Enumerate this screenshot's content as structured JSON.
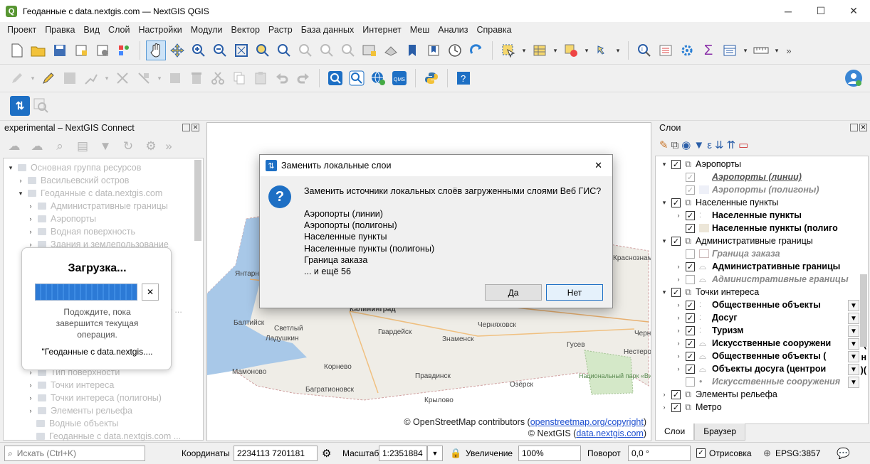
{
  "window": {
    "title": "Геоданные с data.nextgis.com — NextGIS QGIS",
    "app_icon": "Q",
    "minimize": "─",
    "maximize": "☐",
    "close": "✕"
  },
  "menu": [
    "Проект",
    "Правка",
    "Вид",
    "Слой",
    "Настройки",
    "Модули",
    "Вектор",
    "Растр",
    "База данных",
    "Интернет",
    "Меш",
    "Анализ",
    "Справка"
  ],
  "connect_panel": {
    "title": "experimental – NextGIS Connect",
    "tree": [
      "Основная группа ресурсов",
      "Васильевский остров",
      "Геоданные с data.nextgis.com",
      "Административные границы",
      "Аэропорты",
      "Водная поверхность",
      "Здания и землепользование",
      "Тип поверхности",
      "Точки интереса",
      "Точки интереса (полигоны)",
      "Элементы рельефа",
      "Водные объекты",
      "Геоданные с data.nextgis.com ..."
    ],
    "clipped_item": "е ..."
  },
  "loading": {
    "title": "Загрузка...",
    "message": "Подождите, пока завершится текущая операция.",
    "item": "\"Геоданные с data.nextgis....",
    "cancel": "✕"
  },
  "dialog": {
    "title": "Заменить локальные слои",
    "question": "Заменить источники локальных слоёв загруженными слоями Веб ГИС?",
    "layers": [
      "Аэропорты (линии)",
      "Аэропорты (полигоны)",
      "Населенные пункты",
      "Населенные пункты (полигоны)",
      "Граница заказа",
      "... и ещё 56"
    ],
    "yes": "Да",
    "no": "Нет",
    "close": "✕"
  },
  "map": {
    "labels": [
      "Янтарный",
      "Балтийск",
      "Светлый",
      "Ладушкин",
      "Калининград",
      "Гвардейск",
      "Черняховск",
      "Знаменск",
      "Гусев",
      "Нестеров",
      "Мамоново",
      "Корнево",
      "Правдинск",
      "Озёрск",
      "Багратионовск",
      "Крылово",
      "Черн",
      "Краснознаменск",
      "Национальный парк «Виштынецкий»"
    ],
    "attribution_osm": "© OpenStreetMap contributors (openstreetmap.org/copyright)",
    "attribution_osm_link": "openstreetmap.org/copyright",
    "attribution_ngw": "© NextGIS (data.nextgis.com)",
    "attribution_ngw_link": "data.nextgis.com"
  },
  "layers_panel": {
    "title": "Слои",
    "rows": [
      {
        "label": "Аэропорты",
        "type": "group"
      },
      {
        "label": "Аэропорты (линии)",
        "type": "layer"
      },
      {
        "label": "Аэропорты (полигоны)",
        "type": "layer"
      },
      {
        "label": "Населенные пункты",
        "type": "group"
      },
      {
        "label": "Населенные пункты",
        "type": "layer"
      },
      {
        "label": "Населенные пункты (полиго",
        "type": "layer"
      },
      {
        "label": "Административные границы",
        "type": "group"
      },
      {
        "label": "Граница заказа",
        "type": "layer"
      },
      {
        "label": "Административные границы",
        "type": "layer"
      },
      {
        "label": "Административные границы",
        "type": "layer"
      },
      {
        "label": "Точки интереса",
        "type": "group"
      },
      {
        "label": "Общественные объекты",
        "type": "layer"
      },
      {
        "label": "Досуг",
        "type": "layer"
      },
      {
        "label": "Туризм",
        "type": "layer"
      },
      {
        "label": "Искусственные сооружени",
        "type": "layer"
      },
      {
        "label": "Общественные объекты (",
        "type": "layer"
      },
      {
        "label": "Объекты досуга (центрои",
        "type": "layer"
      },
      {
        "label": "Искусственные сооружения",
        "type": "layer"
      },
      {
        "label": "Элементы рельефа",
        "type": "group"
      },
      {
        "label": "Метро",
        "type": "group"
      }
    ],
    "suffix_a": "(",
    "suffix_b": "н",
    "suffix_c": ")(",
    "tabs": [
      "Слои",
      "Браузер"
    ]
  },
  "status": {
    "search_placeholder": "Искать (Ctrl+K)",
    "coords_label": "Координаты",
    "coords_value": "2234113  7201181",
    "scale_label": "Масштаб",
    "scale_value": "1:2351884",
    "zoom_label": "Увеличение",
    "zoom_value": "100%",
    "rotation_label": "Поворот",
    "rotation_value": "0,0 °",
    "render_label": "Отрисовка",
    "crs": "EPSG:3857"
  }
}
